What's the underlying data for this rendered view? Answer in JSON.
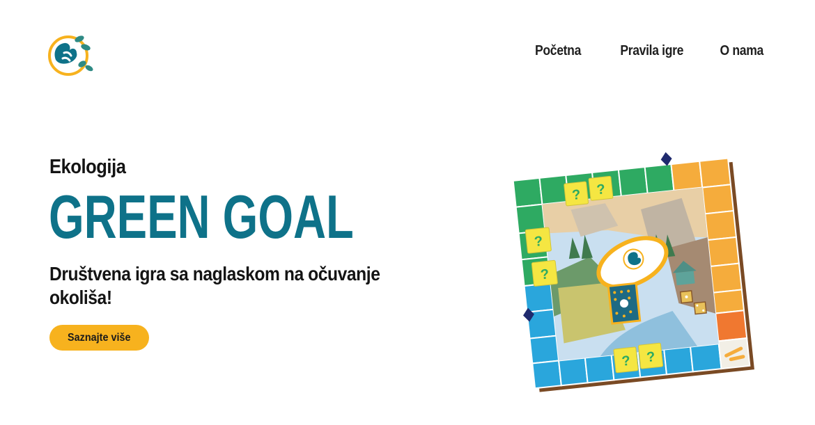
{
  "header": {
    "logo": {
      "icon": "hands-leaves-logo-icon"
    },
    "nav": [
      {
        "label": "Početna"
      },
      {
        "label": "Pravila igre"
      },
      {
        "label": "O nama"
      }
    ]
  },
  "hero": {
    "category": "Ekologija",
    "title": "GREEN GOAL",
    "subtitle": "Društvena igra sa naglaskom na očuvanje okoliša!",
    "cta_label": "Saznajte više"
  },
  "board": {
    "card_symbol": "?",
    "icon": "board-game-illustration-icon"
  },
  "colors": {
    "brand_teal": "#0e7289",
    "accent_yellow": "#f7b21e",
    "board_green": "#2eaa62",
    "board_orange": "#f5ac3c",
    "board_blue": "#2aa6dc",
    "card_yellow": "#f5e642",
    "board_border": "#7a4a24"
  }
}
